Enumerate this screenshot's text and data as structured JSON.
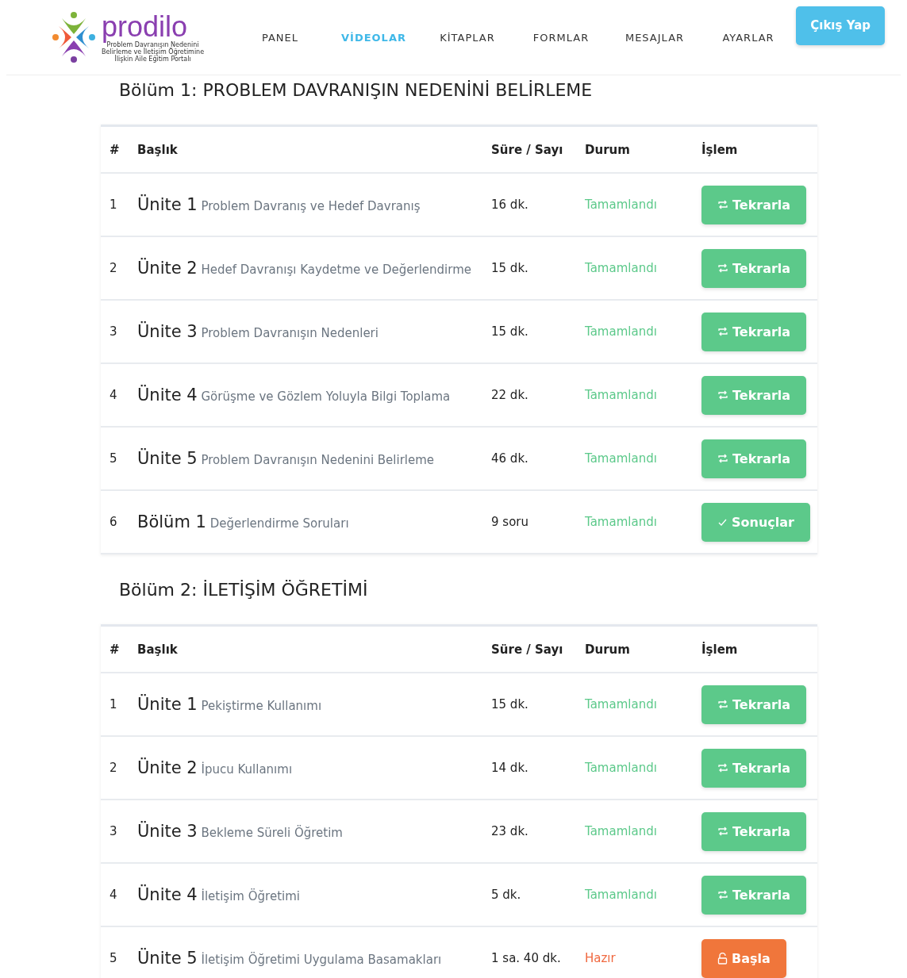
{
  "logo": {
    "name": "prodilo",
    "tagline": [
      "Problem Davranışın Nedenini",
      "Belirleme ve İletişim Öğretimine",
      "İlişkin Aile Eğitim Portalı"
    ]
  },
  "nav": [
    {
      "label": "PANEL",
      "selected": false
    },
    {
      "label": "VİDEOLAR",
      "selected": true
    },
    {
      "label": "KİTAPLAR",
      "selected": false
    },
    {
      "label": "FORMLAR",
      "selected": false
    },
    {
      "label": "MESAJLAR",
      "selected": false
    },
    {
      "label": "AYARLAR",
      "selected": false
    }
  ],
  "logout_button": "Çıkış Yap",
  "sections": [
    {
      "title": "Bölüm 1: PROBLEM DAVRANIŞIN NEDENİNİ BELİRLEME",
      "columns": [
        "#",
        "Başlık",
        "Süre / Sayı",
        "Durum",
        "İşlem"
      ],
      "rows": [
        {
          "no": "1",
          "unit": "Ünite 1",
          "subtitle": "Problem Davranış ve Hedef Davranış",
          "duration": "16 dk.",
          "status": {
            "text": "Tamamlandı",
            "kind": "done"
          },
          "action": {
            "label": "Tekrarla",
            "kind": "repeat"
          }
        },
        {
          "no": "2",
          "unit": "Ünite 2",
          "subtitle": "Hedef Davranışı Kaydetme ve Değerlendirme",
          "duration": "15 dk.",
          "status": {
            "text": "Tamamlandı",
            "kind": "done"
          },
          "action": {
            "label": "Tekrarla",
            "kind": "repeat"
          }
        },
        {
          "no": "3",
          "unit": "Ünite 3",
          "subtitle": "Problem Davranışın Nedenleri",
          "duration": "15 dk.",
          "status": {
            "text": "Tamamlandı",
            "kind": "done"
          },
          "action": {
            "label": "Tekrarla",
            "kind": "repeat"
          }
        },
        {
          "no": "4",
          "unit": "Ünite 4",
          "subtitle": "Görüşme ve Gözlem Yoluyla Bilgi Toplama",
          "duration": "22 dk.",
          "status": {
            "text": "Tamamlandı",
            "kind": "done"
          },
          "action": {
            "label": "Tekrarla",
            "kind": "repeat"
          }
        },
        {
          "no": "5",
          "unit": "Ünite 5",
          "subtitle": "Problem Davranışın Nedenini Belirleme",
          "duration": "46 dk.",
          "status": {
            "text": "Tamamlandı",
            "kind": "done"
          },
          "action": {
            "label": "Tekrarla",
            "kind": "repeat"
          }
        },
        {
          "no": "6",
          "unit": "Bölüm 1",
          "subtitle": "Değerlendirme Soruları",
          "duration": "9 soru",
          "status": {
            "text": "Tamamlandı",
            "kind": "done"
          },
          "action": {
            "label": "Sonuçlar",
            "kind": "results"
          }
        }
      ]
    },
    {
      "title": "Bölüm 2: İLETİŞİM ÖĞRETİMİ",
      "columns": [
        "#",
        "Başlık",
        "Süre / Sayı",
        "Durum",
        "İşlem"
      ],
      "rows": [
        {
          "no": "1",
          "unit": "Ünite 1",
          "subtitle": "Pekiştirme Kullanımı",
          "duration": "15 dk.",
          "status": {
            "text": "Tamamlandı",
            "kind": "done"
          },
          "action": {
            "label": "Tekrarla",
            "kind": "repeat"
          }
        },
        {
          "no": "2",
          "unit": "Ünite 2",
          "subtitle": "İpucu Kullanımı",
          "duration": "14 dk.",
          "status": {
            "text": "Tamamlandı",
            "kind": "done"
          },
          "action": {
            "label": "Tekrarla",
            "kind": "repeat"
          }
        },
        {
          "no": "3",
          "unit": "Ünite 3",
          "subtitle": "Bekleme Süreli Öğretim",
          "duration": "23 dk.",
          "status": {
            "text": "Tamamlandı",
            "kind": "done"
          },
          "action": {
            "label": "Tekrarla",
            "kind": "repeat"
          }
        },
        {
          "no": "4",
          "unit": "Ünite 4",
          "subtitle": "İletişim Öğretimi",
          "duration": "5 dk.",
          "status": {
            "text": "Tamamlandı",
            "kind": "done"
          },
          "action": {
            "label": "Tekrarla",
            "kind": "repeat"
          }
        },
        {
          "no": "5",
          "unit": "Ünite 5",
          "subtitle": "İletişim Öğretimi Uygulama Basamakları",
          "duration": "1 sa. 40 dk.",
          "status": {
            "text": "Hazır",
            "kind": "ready"
          },
          "action": {
            "label": "Başla",
            "kind": "start"
          }
        }
      ]
    }
  ]
}
